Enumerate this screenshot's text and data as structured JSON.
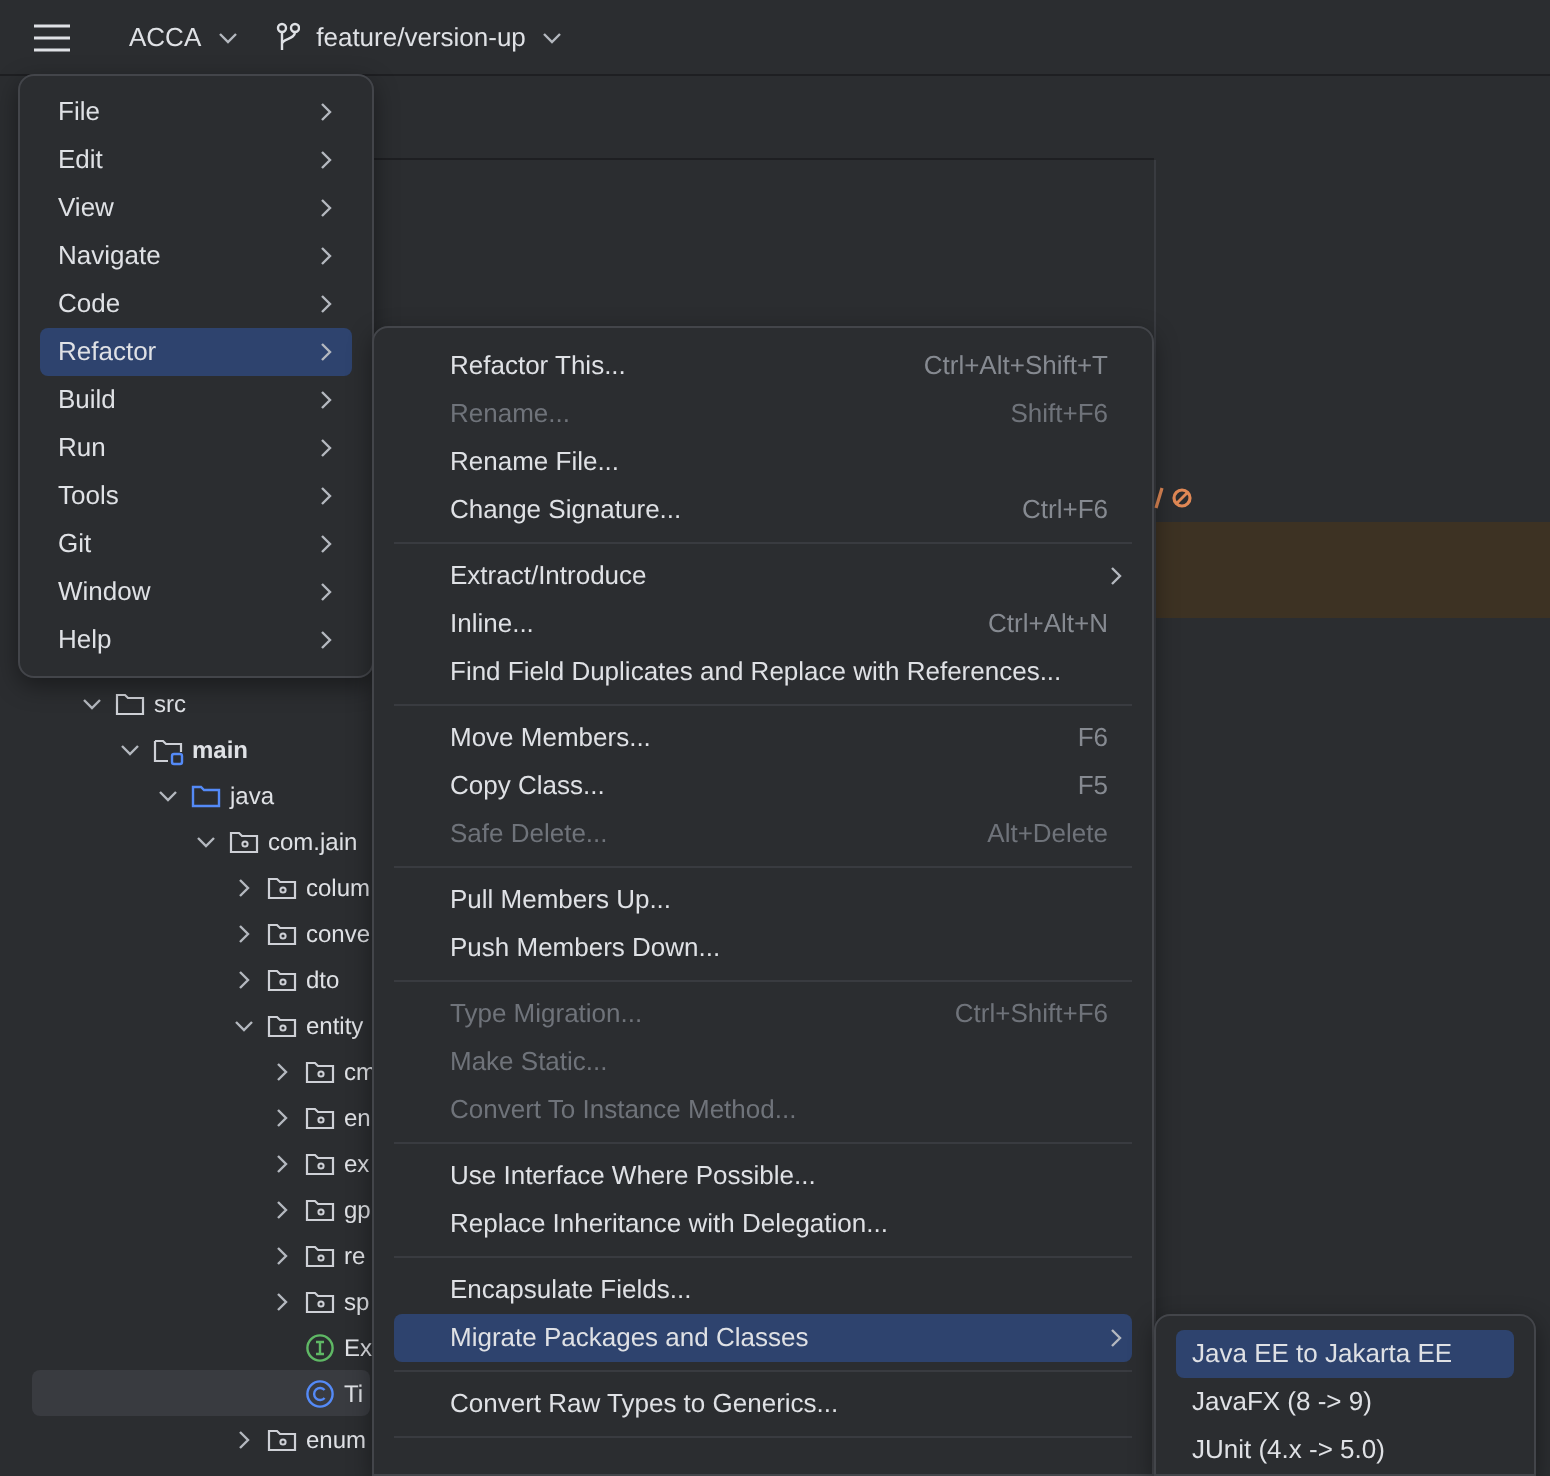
{
  "toolbar": {
    "project": "ACCA",
    "branch": "feature/version-up"
  },
  "main_menu": [
    {
      "label": "File",
      "selected": false
    },
    {
      "label": "Edit",
      "selected": false
    },
    {
      "label": "View",
      "selected": false
    },
    {
      "label": "Navigate",
      "selected": false
    },
    {
      "label": "Code",
      "selected": false
    },
    {
      "label": "Refactor",
      "selected": true
    },
    {
      "label": "Build",
      "selected": false
    },
    {
      "label": "Run",
      "selected": false
    },
    {
      "label": "Tools",
      "selected": false
    },
    {
      "label": "Git",
      "selected": false
    },
    {
      "label": "Window",
      "selected": false
    },
    {
      "label": "Help",
      "selected": false
    }
  ],
  "refactor_menu": [
    {
      "kind": "item",
      "label": "Refactor This...",
      "shortcut": "Ctrl+Alt+Shift+T",
      "disabled": false,
      "selected": false
    },
    {
      "kind": "item",
      "label": "Rename...",
      "shortcut": "Shift+F6",
      "disabled": true,
      "selected": false
    },
    {
      "kind": "item",
      "label": "Rename File...",
      "disabled": false,
      "selected": false
    },
    {
      "kind": "item",
      "label": "Change Signature...",
      "shortcut": "Ctrl+F6",
      "disabled": false,
      "selected": false
    },
    {
      "kind": "separator"
    },
    {
      "kind": "submenu",
      "label": "Extract/Introduce",
      "disabled": false,
      "selected": false
    },
    {
      "kind": "item",
      "label": "Inline...",
      "shortcut": "Ctrl+Alt+N",
      "disabled": false,
      "selected": false
    },
    {
      "kind": "item",
      "label": "Find Field Duplicates and Replace with References...",
      "disabled": false,
      "selected": false
    },
    {
      "kind": "separator"
    },
    {
      "kind": "item",
      "label": "Move Members...",
      "shortcut": "F6",
      "disabled": false,
      "selected": false
    },
    {
      "kind": "item",
      "label": "Copy Class...",
      "shortcut": "F5",
      "disabled": false,
      "selected": false
    },
    {
      "kind": "item",
      "label": "Safe Delete...",
      "shortcut": "Alt+Delete",
      "disabled": true,
      "selected": false
    },
    {
      "kind": "separator"
    },
    {
      "kind": "item",
      "label": "Pull Members Up...",
      "disabled": false,
      "selected": false
    },
    {
      "kind": "item",
      "label": "Push Members Down...",
      "disabled": false,
      "selected": false
    },
    {
      "kind": "separator"
    },
    {
      "kind": "item",
      "label": "Type Migration...",
      "shortcut": "Ctrl+Shift+F6",
      "disabled": true,
      "selected": false
    },
    {
      "kind": "item",
      "label": "Make Static...",
      "disabled": true,
      "selected": false
    },
    {
      "kind": "item",
      "label": "Convert To Instance Method...",
      "disabled": true,
      "selected": false
    },
    {
      "kind": "separator"
    },
    {
      "kind": "item",
      "label": "Use Interface Where Possible...",
      "disabled": false,
      "selected": false
    },
    {
      "kind": "item",
      "label": "Replace Inheritance with Delegation...",
      "disabled": false,
      "selected": false
    },
    {
      "kind": "separator"
    },
    {
      "kind": "item",
      "label": "Encapsulate Fields...",
      "disabled": false,
      "selected": false
    },
    {
      "kind": "submenu",
      "label": "Migrate Packages and Classes",
      "disabled": false,
      "selected": true
    },
    {
      "kind": "separator"
    },
    {
      "kind": "item",
      "label": "Convert Raw Types to Generics...",
      "disabled": false,
      "selected": false
    },
    {
      "kind": "separator"
    }
  ],
  "migrate_menu": [
    {
      "label": "Java EE to Jakarta EE",
      "selected": true
    },
    {
      "label": "JavaFX (8 -> 9)",
      "selected": false
    },
    {
      "label": "JUnit (4.x -> 5.0)",
      "selected": false
    }
  ],
  "project_tree": [
    {
      "name": "src",
      "kind": "folder",
      "expanded": true,
      "selected": false,
      "children": [
        {
          "name": "main",
          "kind": "module",
          "expanded": true,
          "selected": false,
          "children": [
            {
              "name": "java",
              "kind": "source",
              "expanded": true,
              "selected": false,
              "children": [
                {
                  "name": "com.jain",
                  "kind": "package",
                  "expanded": true,
                  "selected": false,
                  "children": [
                    {
                      "name": "colum",
                      "kind": "package",
                      "expanded": false,
                      "selected": false
                    },
                    {
                      "name": "conve",
                      "kind": "package",
                      "expanded": false,
                      "selected": false
                    },
                    {
                      "name": "dto",
                      "kind": "package",
                      "expanded": false,
                      "selected": false
                    },
                    {
                      "name": "entity",
                      "kind": "package",
                      "expanded": true,
                      "selected": false,
                      "children": [
                        {
                          "name": "cm",
                          "kind": "package",
                          "expanded": false,
                          "selected": false
                        },
                        {
                          "name": "en",
                          "kind": "package",
                          "expanded": false,
                          "selected": false
                        },
                        {
                          "name": "ex",
                          "kind": "package",
                          "expanded": false,
                          "selected": false
                        },
                        {
                          "name": "gp",
                          "kind": "package",
                          "expanded": false,
                          "selected": false
                        },
                        {
                          "name": "re",
                          "kind": "package",
                          "expanded": false,
                          "selected": false
                        },
                        {
                          "name": "sp",
                          "kind": "package",
                          "expanded": false,
                          "selected": false
                        },
                        {
                          "name": "Ex",
                          "kind": "interface",
                          "selected": false
                        },
                        {
                          "name": "Ti",
                          "kind": "class",
                          "selected": true
                        }
                      ]
                    },
                    {
                      "name": "enum",
                      "kind": "package",
                      "expanded": false,
                      "selected": false
                    }
                  ]
                }
              ]
            }
          ]
        }
      ]
    }
  ]
}
